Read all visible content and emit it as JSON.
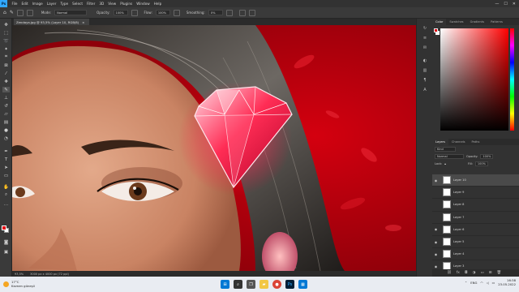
{
  "menubar": {
    "logo": "Ps",
    "items": [
      "File",
      "Edit",
      "Image",
      "Layer",
      "Type",
      "Select",
      "Filter",
      "3D",
      "View",
      "Plugins",
      "Window",
      "Help"
    ],
    "controls": [
      "—",
      "☐",
      "✕"
    ]
  },
  "options": {
    "mode_label": "Mode:",
    "mode_value": "Normal",
    "opacity_label": "Opacity:",
    "opacity_value": "100%",
    "flow_label": "Flow:",
    "flow_value": "100%",
    "smoothing_label": "Smoothing:",
    "smoothing_value": "0%"
  },
  "document": {
    "tab_title": "Zendaya.jpg @ 93,5% (Layer 10, RGB/8)",
    "close": "×"
  },
  "status": {
    "zoom": "93,5%",
    "size": "3000 px x 4000 px (72 ppi)"
  },
  "color_panel": {
    "tabs": [
      "Color",
      "Swatches",
      "Gradients",
      "Patterns"
    ],
    "fg_color": "#e30613",
    "bg_color": "#ffffff"
  },
  "layers_panel": {
    "tabs": [
      "Layers",
      "Channels",
      "Paths"
    ],
    "kind_label": "Kind",
    "blend_mode": "Normal",
    "opacity_label": "Opacity:",
    "opacity_value": "100%",
    "lock_label": "Lock:",
    "fill_label": "Fill:",
    "fill_value": "100%",
    "layers": [
      {
        "name": "Layer 10",
        "visible": true,
        "selected": true
      },
      {
        "name": "Layer 9",
        "visible": false,
        "selected": false
      },
      {
        "name": "Layer 8",
        "visible": false,
        "selected": false
      },
      {
        "name": "Layer 7",
        "visible": false,
        "selected": false
      },
      {
        "name": "Layer 6",
        "visible": true,
        "selected": false
      },
      {
        "name": "Layer 5",
        "visible": true,
        "selected": false
      },
      {
        "name": "Layer 4",
        "visible": true,
        "selected": false
      },
      {
        "name": "Layer 3",
        "visible": true,
        "selected": false
      }
    ]
  },
  "taskbar": {
    "weather_temp": "17°C",
    "weather_desc": "Kısmen güneşli",
    "language": "ENG",
    "time": "16:38",
    "date": "23.05.2022",
    "colors": {
      "start": "#0078d4",
      "search": "#333333",
      "taskview": "#555555",
      "explorer": "#f2c744",
      "chrome": "#db4437",
      "photoshop": "#001e36",
      "store": "#0078d4"
    }
  }
}
